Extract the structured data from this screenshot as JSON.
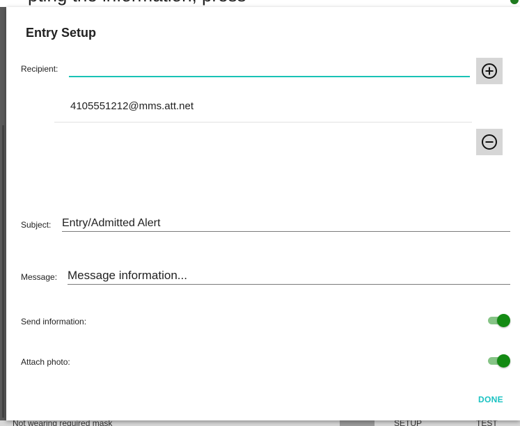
{
  "background": {
    "top_text": "pting the information, press",
    "status_text": "Not wearing required mask",
    "setup_label": "SETUP",
    "test_label": "TEST"
  },
  "dialog": {
    "title": "Entry Setup",
    "recipient": {
      "label": "Recipient:",
      "value": "",
      "add_icon": "plus-circle-icon",
      "remove_icon": "minus-circle-icon",
      "items": [
        "4105551212@mms.att.net"
      ]
    },
    "subject": {
      "label": "Subject:",
      "value": "Entry/Admitted Alert"
    },
    "message": {
      "label": "Message:",
      "value": "Message information..."
    },
    "send_information": {
      "label": "Send information:",
      "on": true
    },
    "attach_photo": {
      "label": "Attach photo:",
      "on": true
    },
    "done_label": "DONE"
  },
  "colors": {
    "accent": "#19c2b5",
    "toggle_thumb": "#138a13",
    "toggle_track": "#86c486",
    "done_text": "#19c2c2"
  }
}
